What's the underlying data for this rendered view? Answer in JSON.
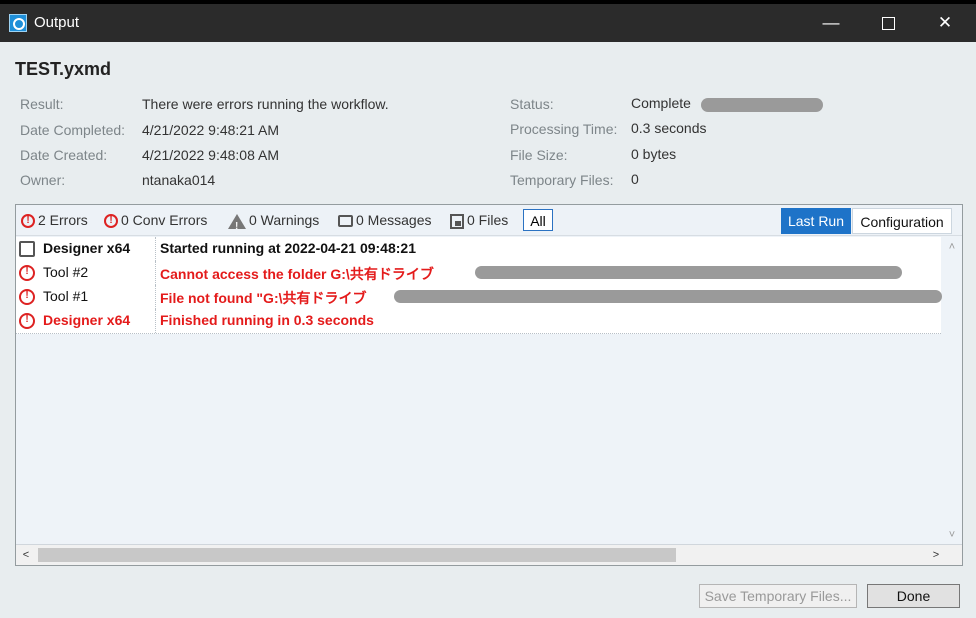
{
  "window": {
    "title": "Output"
  },
  "title_controls": {
    "minimize": "—",
    "close": "✕"
  },
  "file": {
    "name": "TEST.yxmd"
  },
  "info": {
    "left": [
      {
        "label": "Result:",
        "value": "There were errors running the workflow."
      },
      {
        "label": "Date Completed:",
        "value": "4/21/2022 9:48:21 AM"
      },
      {
        "label": "Date Created:",
        "value": "4/21/2022 9:48:08 AM"
      },
      {
        "label": "Owner:",
        "value": "ntanaka014"
      }
    ],
    "right": [
      {
        "label": "Status:",
        "value": "Complete"
      },
      {
        "label": "Processing Time:",
        "value": "0.3 seconds"
      },
      {
        "label": "File Size:",
        "value": "0 bytes"
      },
      {
        "label": "Temporary Files:",
        "value": "0"
      }
    ]
  },
  "filters": [
    {
      "label": "2 Errors",
      "icon": "error-icon"
    },
    {
      "label": "0 Conv Errors",
      "icon": "error-icon"
    },
    {
      "label": "0 Warnings",
      "icon": "warning-icon"
    },
    {
      "label": "0 Messages",
      "icon": "message-icon"
    },
    {
      "label": "0 Files",
      "icon": "file-icon"
    },
    {
      "label": "All",
      "selected": true
    }
  ],
  "tabs": {
    "last_run": "Last Run",
    "configuration": "Configuration"
  },
  "log": [
    {
      "tool": "Designer x64",
      "message": "Started running at 2022-04-21 09:48:21",
      "type": "message"
    },
    {
      "tool": "Tool #2",
      "message": "Cannot access the folder G:\\共有ドライブ",
      "type": "error"
    },
    {
      "tool": "Tool #1",
      "message": "File not found \"G:\\共有ドライブ",
      "type": "error"
    },
    {
      "tool": "Designer x64",
      "message": "Finished running in 0.3 seconds",
      "type": "error-summary"
    }
  ],
  "scroll_arrows": {
    "up": "˄",
    "down": "˅",
    "left": "<",
    "right": ">"
  },
  "buttons": {
    "save": "Save Temporary Files...",
    "done": "Done"
  },
  "colors": {
    "accent": "#1e73c8",
    "error": "#e41b1b"
  }
}
